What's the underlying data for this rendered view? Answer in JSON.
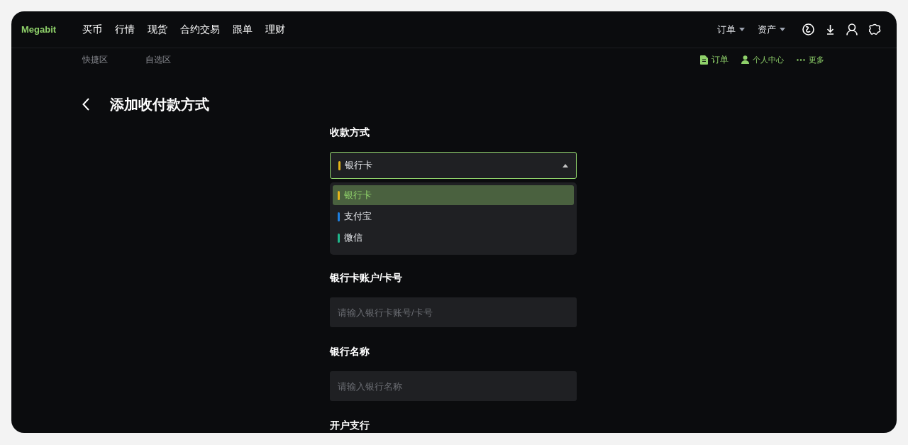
{
  "nav": {
    "logo": "Megabit",
    "items": [
      "买币",
      "行情",
      "现货",
      "合约交易",
      "跟单",
      "理财"
    ],
    "menus": [
      {
        "label": "订单"
      },
      {
        "label": "资产"
      }
    ]
  },
  "subnav": {
    "tabs": [
      "快捷区",
      "自选区"
    ],
    "links": [
      {
        "label": "订单",
        "kind": "doc"
      },
      {
        "label": "个人中心",
        "kind": "user"
      },
      {
        "label": "更多",
        "kind": "more"
      }
    ]
  },
  "page": {
    "title": "添加收付款方式"
  },
  "form": {
    "method": {
      "label": "收款方式",
      "value": "银行卡",
      "color": "#e5b41a",
      "expanded": true,
      "options": [
        {
          "label": "银行卡",
          "color": "#e5b41a",
          "selected": true
        },
        {
          "label": "支付宝",
          "color": "#1e7fe0",
          "selected": false
        },
        {
          "label": "微信",
          "color": "#1fb68a",
          "selected": false
        }
      ]
    },
    "fields": [
      {
        "label": "银行卡账户/卡号",
        "placeholder": "请输入银行卡账号/卡号"
      },
      {
        "label": "银行名称",
        "placeholder": "请输入银行名称"
      }
    ],
    "next_label": "开户支行"
  }
}
